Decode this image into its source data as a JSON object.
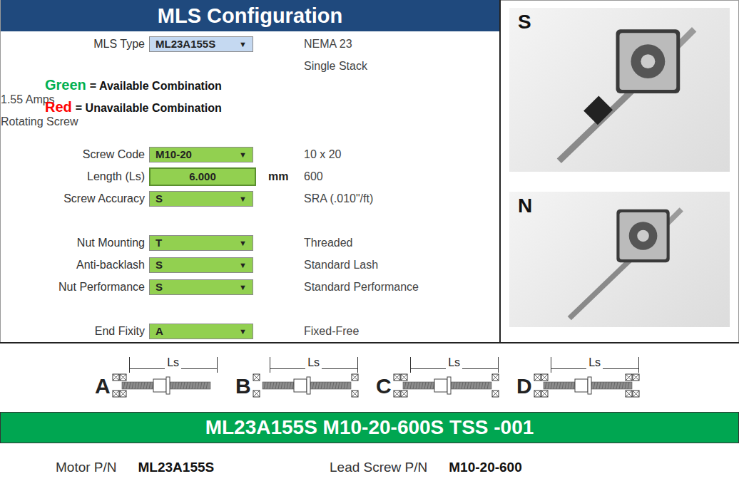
{
  "header": {
    "title": "MLS Configuration"
  },
  "rows": [
    {
      "kind": "select",
      "label": "MLS Type",
      "value": "ML23A155S",
      "arrow": "▼",
      "color": "#c5d9f1",
      "description": "NEMA 23"
    },
    {
      "kind": "blank",
      "description": "Single Stack"
    },
    {
      "kind": "legend",
      "word": "Green",
      "text": "= Available Combination",
      "color": "#00b050",
      "description": "1.55 Amps"
    },
    {
      "kind": "legend",
      "word": "Red",
      "text": "= Unavailable Combination",
      "color": "#ff0000",
      "description": "Rotating Screw"
    },
    {
      "kind": "blank"
    },
    {
      "kind": "select",
      "label": "Screw Code",
      "value": "M10-20",
      "arrow": "▼",
      "color": "#92d050",
      "description": "10 x 20"
    },
    {
      "kind": "input",
      "label": "Length (Ls)",
      "value": "6.000",
      "unit": "mm",
      "color": "#92d050",
      "description": "600"
    },
    {
      "kind": "select",
      "label": "Screw Accuracy",
      "value": "S",
      "arrow": "▼",
      "color": "#92d050",
      "description": "SRA (.010\"/ft)"
    },
    {
      "kind": "blank"
    },
    {
      "kind": "select",
      "label": "Nut Mounting",
      "value": "T",
      "arrow": "▼",
      "color": "#92d050",
      "description": "Threaded"
    },
    {
      "kind": "select",
      "label": "Anti-backlash",
      "value": "S",
      "arrow": "▼",
      "color": "#92d050",
      "description": "Standard Lash"
    },
    {
      "kind": "select",
      "label": "Nut Performance",
      "value": "S",
      "arrow": "▼",
      "color": "#92d050",
      "description": "Standard Performance"
    },
    {
      "kind": "blank"
    },
    {
      "kind": "select",
      "label": "End Fixity",
      "value": "A",
      "arrow": "▼",
      "color": "#92d050",
      "description": "Fixed-Free"
    }
  ],
  "photos": [
    {
      "label": "S",
      "kind": "nut"
    },
    {
      "label": "N",
      "kind": "plain"
    }
  ],
  "fixity_diagrams": [
    {
      "letter": "A",
      "dimension": "Ls",
      "kind": "fixed-free"
    },
    {
      "letter": "B",
      "dimension": "Ls",
      "kind": "supported-supported"
    },
    {
      "letter": "C",
      "dimension": "Ls",
      "kind": "fixed-supported"
    },
    {
      "letter": "D",
      "dimension": "Ls",
      "kind": "fixed-fixed"
    }
  ],
  "part_number": "ML23A155S M10-20-600S TSS -001",
  "parts": [
    {
      "label": "Motor P/N",
      "value": "ML23A155S"
    },
    {
      "label": "Lead Screw P/N",
      "value": "M10-20-600"
    }
  ]
}
